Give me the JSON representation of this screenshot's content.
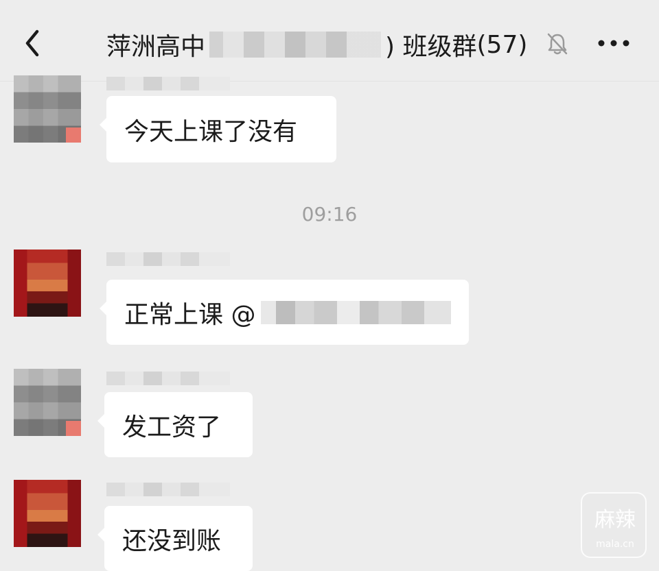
{
  "header": {
    "title_prefix": "萍洲高中",
    "title_suffix": ") 班级群",
    "member_count": "(57)",
    "icons": {
      "back": "back-chevron-icon",
      "mute": "bell-muted-icon",
      "more": "more-dots-icon"
    }
  },
  "timestamp": "09:16",
  "messages": [
    {
      "text": "今天上课了没有"
    },
    {
      "text": "正常上课 @"
    },
    {
      "text": "发工资了"
    },
    {
      "text": "还没到账"
    }
  ],
  "watermark": {
    "text_main": "麻辣",
    "text_sub": "mala.cn"
  },
  "colors": {
    "background": "#ededed",
    "bubble": "#ffffff",
    "text": "#1b1b1b",
    "timestamp": "#9e9e9e"
  }
}
